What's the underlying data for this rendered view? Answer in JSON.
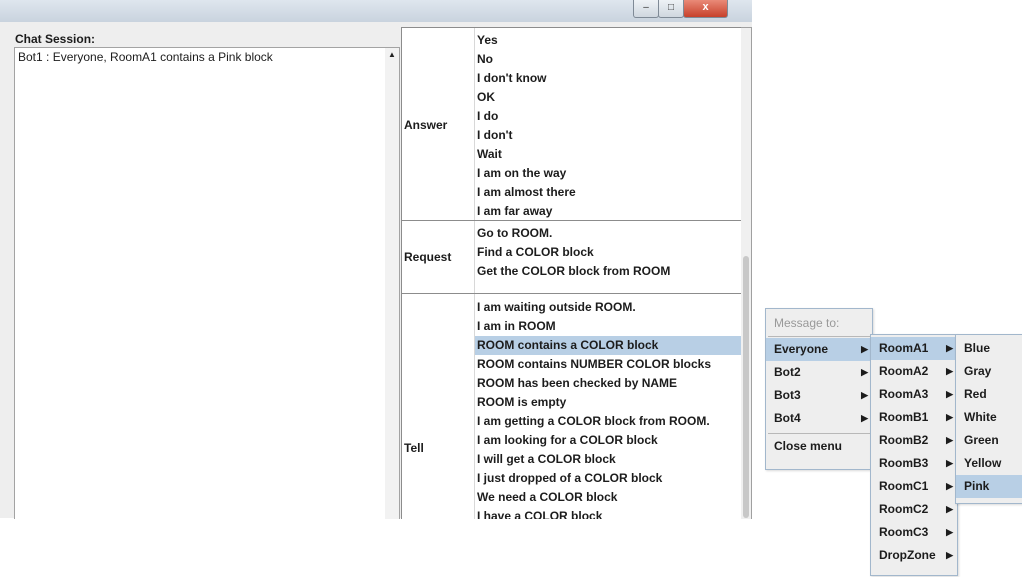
{
  "window": {
    "close_glyph": "x"
  },
  "chat": {
    "title": "Chat Session:",
    "messages": [
      "Bot1 : Everyone, RoomA1 contains a Pink block"
    ],
    "scroll_up": "▲"
  },
  "commands": {
    "sections": [
      {
        "label": "Answer",
        "options": [
          "Yes",
          "No",
          "I don't know",
          "OK",
          "I do",
          "I don't",
          "Wait",
          "I am on the way",
          "I am almost there",
          "I am far away"
        ]
      },
      {
        "label": "Request",
        "options": [
          "Go to ROOM.",
          "Find a COLOR block",
          "Get the COLOR block from ROOM"
        ]
      },
      {
        "label": "Tell",
        "options": [
          "I am waiting outside ROOM.",
          "I am in ROOM",
          "ROOM contains a COLOR block",
          "ROOM contains NUMBER COLOR blocks",
          "ROOM has been checked by NAME",
          "ROOM is empty",
          "I am getting a COLOR block from ROOM.",
          "I am looking for a COLOR block",
          "I will get a COLOR block",
          "I just dropped of a COLOR block",
          "We need a COLOR block",
          "I have a COLOR block"
        ],
        "selected_index": 2
      }
    ]
  },
  "menus": {
    "recipient": {
      "header": "Message to:",
      "items": [
        "Everyone",
        "Bot2",
        "Bot3",
        "Bot4"
      ],
      "close_label": "Close menu",
      "highlighted_index": 0
    },
    "rooms": {
      "items": [
        "RoomA1",
        "RoomA2",
        "RoomA3",
        "RoomB1",
        "RoomB2",
        "RoomB3",
        "RoomC1",
        "RoomC2",
        "RoomC3",
        "DropZone"
      ],
      "highlighted_index": 0
    },
    "colors": {
      "items": [
        "Blue",
        "Gray",
        "Red",
        "White",
        "Green",
        "Yellow",
        "Pink"
      ],
      "highlighted_index": 6
    },
    "submenu_arrow": "▶"
  },
  "colors": {
    "selection": "#b8cfe5",
    "menu_bg": "#eeeeee",
    "close_button": "#c7412b"
  }
}
